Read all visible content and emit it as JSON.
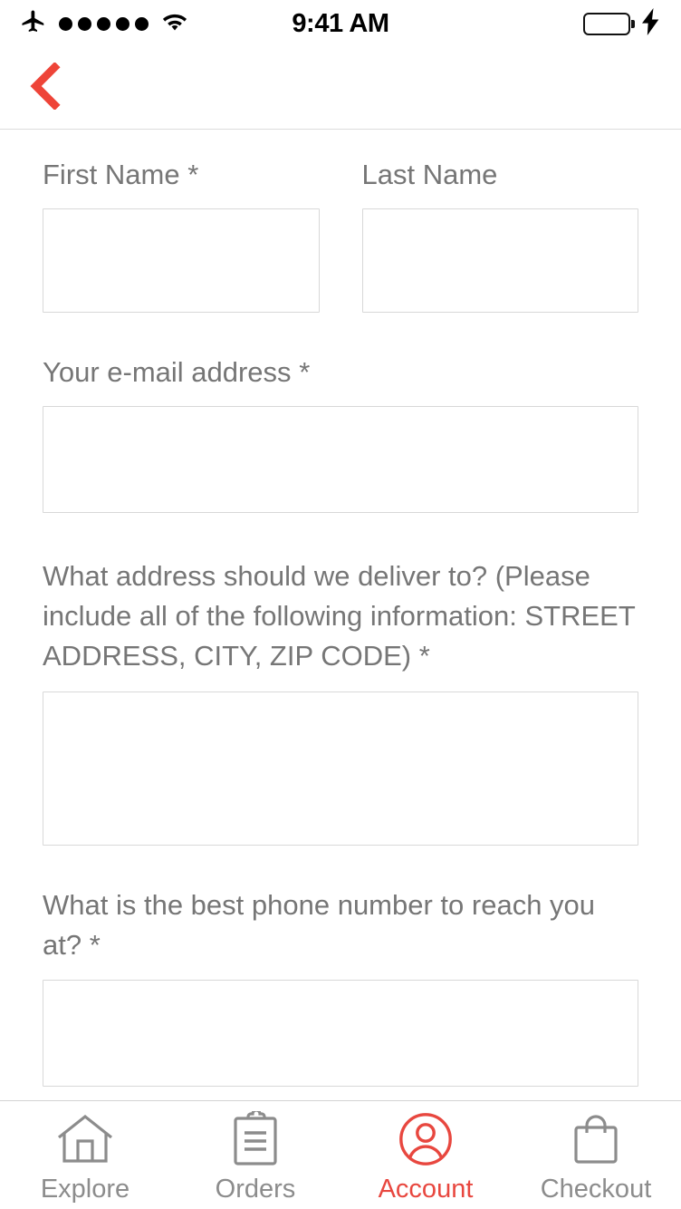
{
  "status_bar": {
    "airplane_icon": "airplane-mode-icon",
    "signal_dots": 5,
    "wifi_icon": "wifi-icon",
    "time": "9:41 AM",
    "battery_icon": "battery-full-icon",
    "charging_icon": "charging-bolt-icon"
  },
  "navbar": {
    "back_icon": "chevron-left-icon"
  },
  "colors": {
    "accent": "#E8473F",
    "label_text": "#767676",
    "tab_inactive": "#8c8c8c",
    "field_border": "#d8d8d8",
    "battery_green": "#4CD964"
  },
  "form": {
    "fields": [
      {
        "id": "first-name",
        "label": "First Name",
        "required_mark": "*",
        "value": "",
        "placeholder": ""
      },
      {
        "id": "last-name",
        "label": "Last Name",
        "required_mark": "",
        "value": "",
        "placeholder": ""
      },
      {
        "id": "email",
        "label": "Your e-mail address",
        "required_mark": "*",
        "value": "",
        "placeholder": ""
      },
      {
        "id": "address",
        "label": "What address should we deliver to? (Please include all of the following information: STREET ADDRESS, CITY, ZIP CODE)",
        "required_mark": "*",
        "value": "",
        "placeholder": ""
      },
      {
        "id": "phone",
        "label": "What is the best phone number to reach you at?",
        "required_mark": "*",
        "value": "",
        "placeholder": ""
      }
    ]
  },
  "tabbar": {
    "items": [
      {
        "label": "Explore",
        "icon": "home-icon",
        "active": false
      },
      {
        "label": "Orders",
        "icon": "clipboard-icon",
        "active": false
      },
      {
        "label": "Account",
        "icon": "user-circle-icon",
        "active": true
      },
      {
        "label": "Checkout",
        "icon": "shopping-bag-icon",
        "active": false
      }
    ]
  }
}
